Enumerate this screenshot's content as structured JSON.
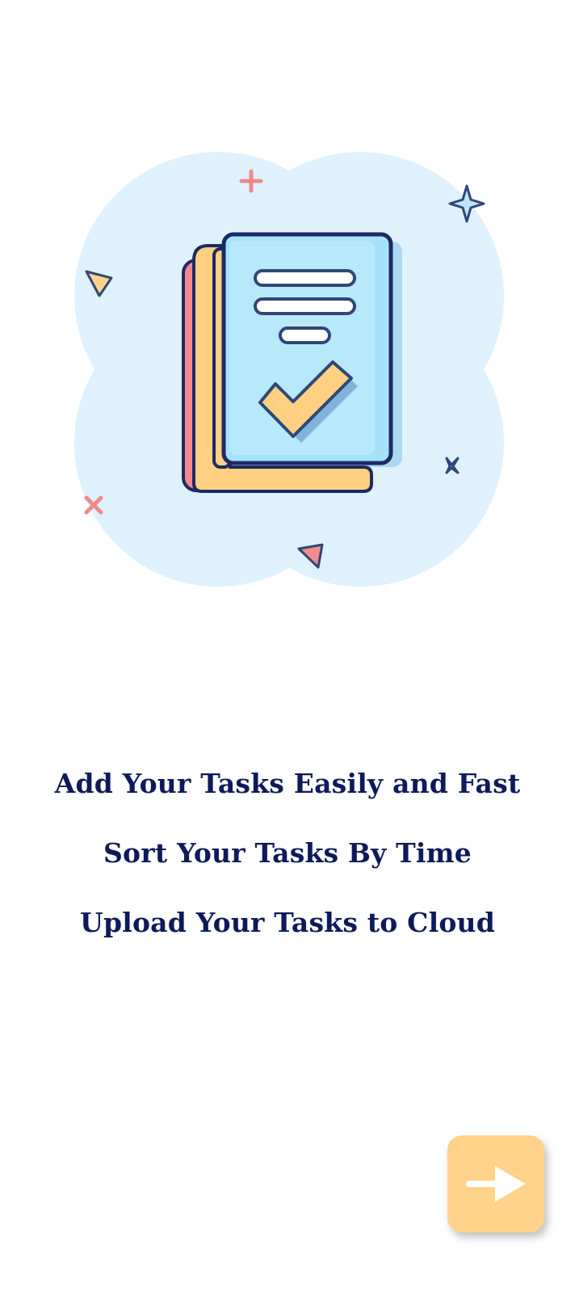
{
  "illustration": {
    "name": "task-book-illustration",
    "background_color": "#dff1fd"
  },
  "features": [
    "Add Your Tasks Easily and Fast",
    "Sort Your Tasks By Time",
    "Upload Your Tasks to Cloud"
  ],
  "next_button": {
    "icon": "arrow-right-icon",
    "color": "#ffd389"
  },
  "colors": {
    "text": "#0e1a5a",
    "accent": "#ffd389"
  }
}
